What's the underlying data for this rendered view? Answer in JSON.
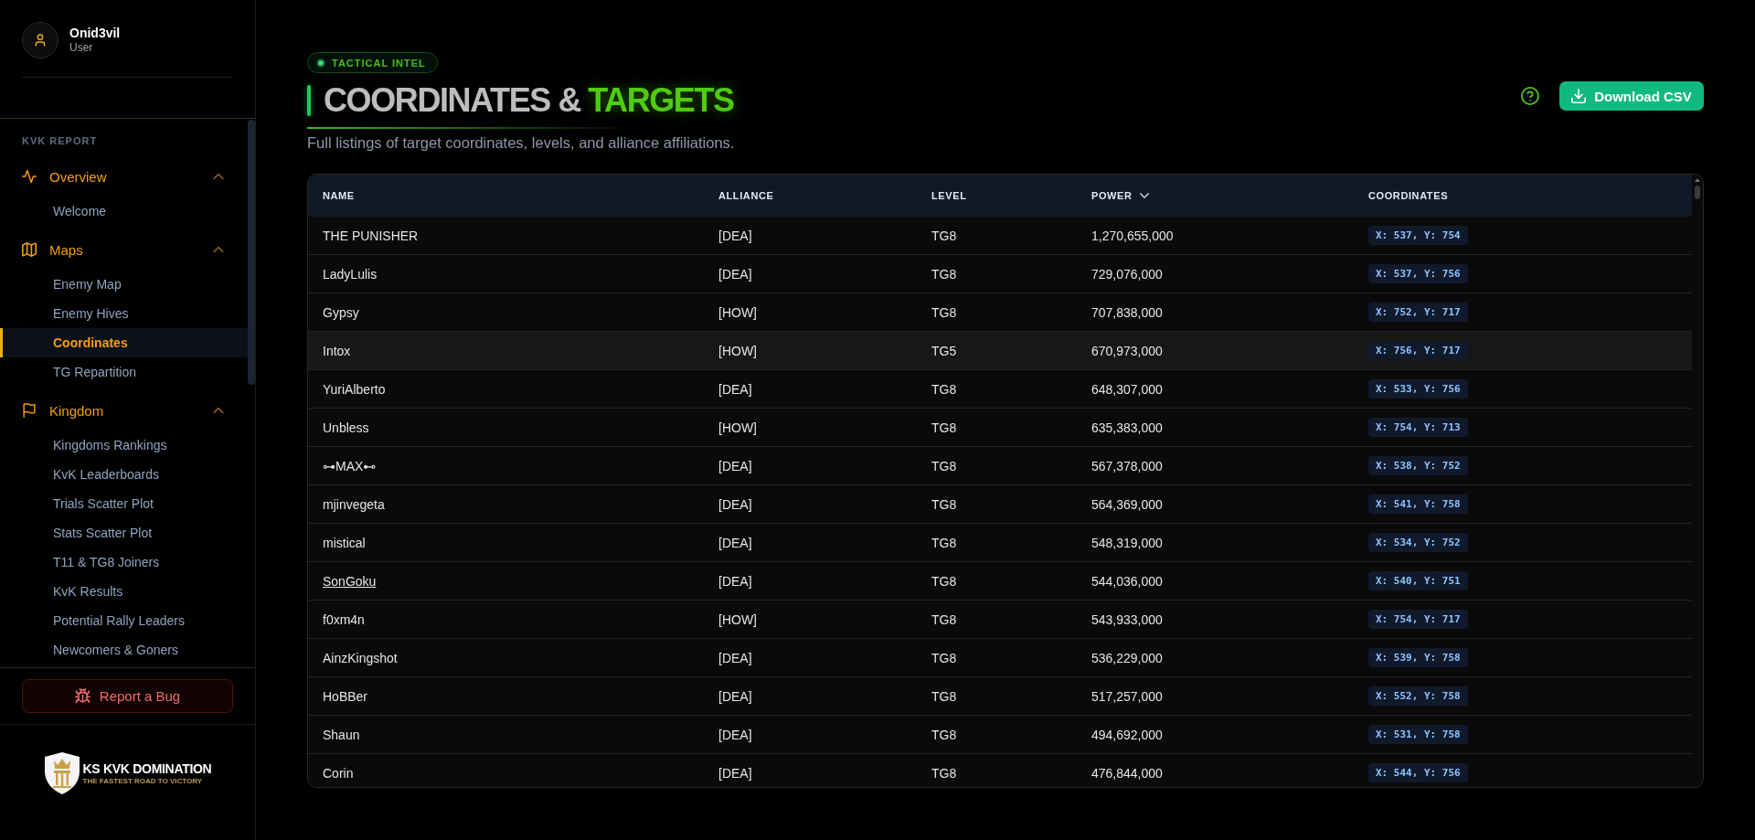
{
  "user": {
    "name": "Onid3vil",
    "role": "User"
  },
  "sidebar": {
    "section_label": "KVK REPORT",
    "groups": [
      {
        "label": "Overview",
        "expanded": true,
        "children": [
          {
            "label": "Welcome",
            "selected": false
          }
        ]
      },
      {
        "label": "Maps",
        "expanded": true,
        "children": [
          {
            "label": "Enemy Map",
            "selected": false
          },
          {
            "label": "Enemy Hives",
            "selected": false
          },
          {
            "label": "Coordinates",
            "selected": true
          },
          {
            "label": "TG Repartition",
            "selected": false
          }
        ]
      },
      {
        "label": "Kingdom",
        "expanded": true,
        "children": [
          {
            "label": "Kingdoms Rankings",
            "selected": false
          },
          {
            "label": "KvK Leaderboards",
            "selected": false
          },
          {
            "label": "Trials Scatter Plot",
            "selected": false
          },
          {
            "label": "Stats Scatter Plot",
            "selected": false
          },
          {
            "label": "T11 & TG8 Joiners",
            "selected": false
          },
          {
            "label": "KvK Results",
            "selected": false
          },
          {
            "label": "Potential Rally Leaders",
            "selected": false
          },
          {
            "label": "Newcomers & Goners",
            "selected": false
          }
        ]
      }
    ]
  },
  "report_button": "Report a Bug",
  "logo": {
    "title": "KS KVK DOMINATION",
    "tagline": "THE FASTEST ROAD TO VICTORY"
  },
  "header": {
    "tag": "TACTICAL INTEL",
    "title_main": "COORDINATES &",
    "title_highlight": "TARGETS",
    "subtitle": "Full listings of target coordinates, levels, and alliance affiliations.",
    "download_button": "Download CSV"
  },
  "table": {
    "columns": [
      {
        "label": "NAME",
        "sorted": false
      },
      {
        "label": "ALLIANCE",
        "sorted": false
      },
      {
        "label": "LEVEL",
        "sorted": false
      },
      {
        "label": "POWER",
        "sorted": true
      },
      {
        "label": "COORDINATES",
        "sorted": false
      }
    ],
    "rows": [
      {
        "name": "THE PUNISHER",
        "alliance": "[DEA]",
        "level": "TG8",
        "power": "1,270,655,000",
        "coordinates": "X: 537, Y: 754",
        "highlighted": false,
        "name_hovered": false
      },
      {
        "name": "LadyLulis",
        "alliance": "[DEA]",
        "level": "TG8",
        "power": "729,076,000",
        "coordinates": "X: 537, Y: 756",
        "highlighted": false,
        "name_hovered": false
      },
      {
        "name": "Gypsy",
        "alliance": "[HOW]",
        "level": "TG8",
        "power": "707,838,000",
        "coordinates": "X: 752, Y: 717",
        "highlighted": false,
        "name_hovered": false
      },
      {
        "name": "Intox",
        "alliance": "[HOW]",
        "level": "TG5",
        "power": "670,973,000",
        "coordinates": "X: 756, Y: 717",
        "highlighted": true,
        "name_hovered": false
      },
      {
        "name": "YuriAlberto",
        "alliance": "[DEA]",
        "level": "TG8",
        "power": "648,307,000",
        "coordinates": "X: 533, Y: 756",
        "highlighted": false,
        "name_hovered": false
      },
      {
        "name": "Unbless",
        "alliance": "[HOW]",
        "level": "TG8",
        "power": "635,383,000",
        "coordinates": "X: 754, Y: 713",
        "highlighted": false,
        "name_hovered": false
      },
      {
        "name": "⊶MAX⊷",
        "alliance": "[DEA]",
        "level": "TG8",
        "power": "567,378,000",
        "coordinates": "X: 538, Y: 752",
        "highlighted": false,
        "name_hovered": false
      },
      {
        "name": "mjinvegeta",
        "alliance": "[DEA]",
        "level": "TG8",
        "power": "564,369,000",
        "coordinates": "X: 541, Y: 758",
        "highlighted": false,
        "name_hovered": false
      },
      {
        "name": "mistical",
        "alliance": "[DEA]",
        "level": "TG8",
        "power": "548,319,000",
        "coordinates": "X: 534, Y: 752",
        "highlighted": false,
        "name_hovered": false
      },
      {
        "name": "SonGoku",
        "alliance": "[DEA]",
        "level": "TG8",
        "power": "544,036,000",
        "coordinates": "X: 540, Y: 751",
        "highlighted": false,
        "name_hovered": true
      },
      {
        "name": "f0xm4n",
        "alliance": "[HOW]",
        "level": "TG8",
        "power": "543,933,000",
        "coordinates": "X: 754, Y: 717",
        "highlighted": false,
        "name_hovered": false
      },
      {
        "name": "AinzKingshot",
        "alliance": "[DEA]",
        "level": "TG8",
        "power": "536,229,000",
        "coordinates": "X: 539, Y: 758",
        "highlighted": false,
        "name_hovered": false
      },
      {
        "name": "HoBBer",
        "alliance": "[DEA]",
        "level": "TG8",
        "power": "517,257,000",
        "coordinates": "X: 552, Y: 758",
        "highlighted": false,
        "name_hovered": false
      },
      {
        "name": "Shaun",
        "alliance": "[DEA]",
        "level": "TG8",
        "power": "494,692,000",
        "coordinates": "X: 531, Y: 758",
        "highlighted": false,
        "name_hovered": false
      },
      {
        "name": "Corin",
        "alliance": "[DEA]",
        "level": "TG8",
        "power": "476,844,000",
        "coordinates": "X: 544, Y: 756",
        "highlighted": false,
        "name_hovered": false
      }
    ]
  }
}
